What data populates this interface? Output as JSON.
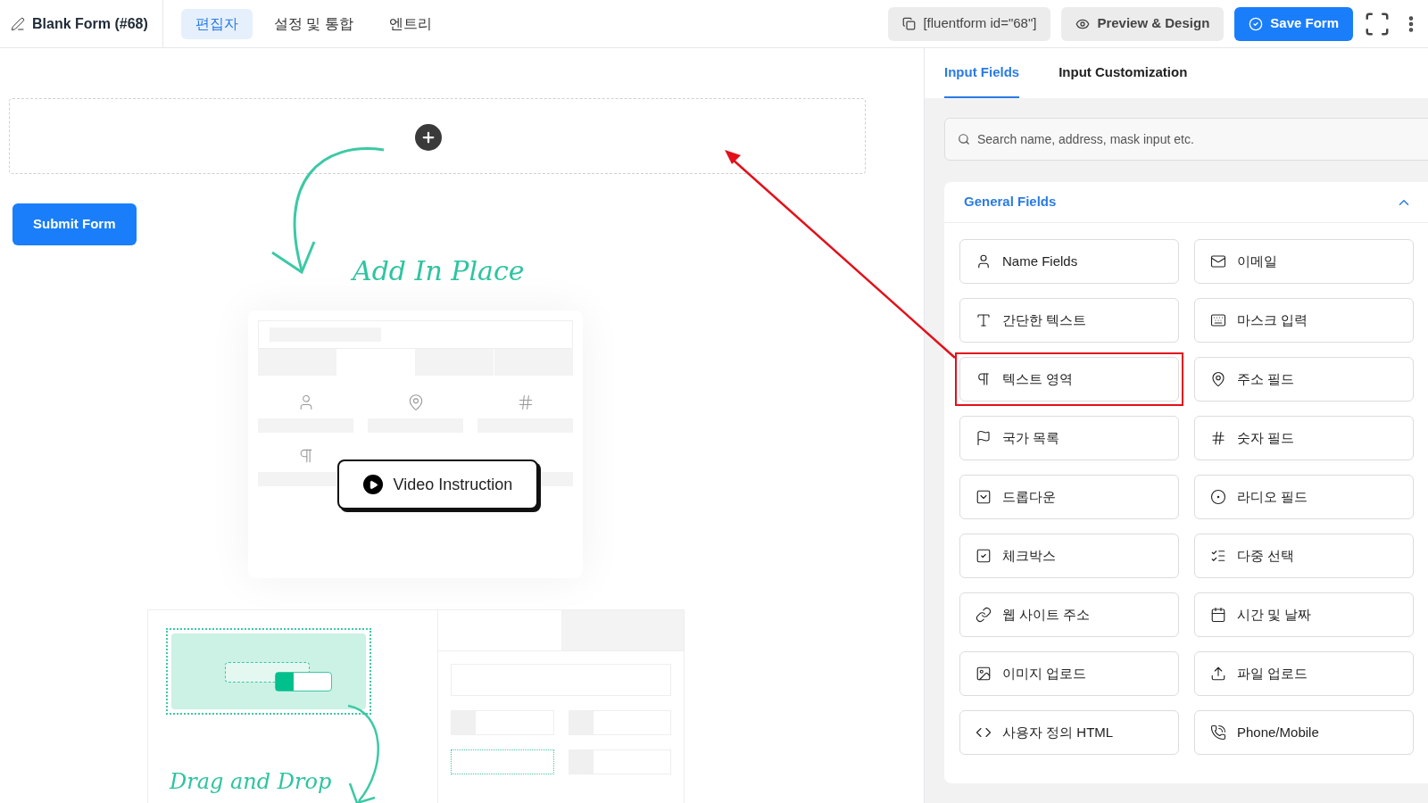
{
  "header": {
    "title": "Blank Form (#68)",
    "tabs": [
      {
        "label": "편집자",
        "selected": true
      },
      {
        "label": "설정 및 통합",
        "selected": false
      },
      {
        "label": "엔트리",
        "selected": false
      }
    ],
    "shortcode": "[fluentform id=\"68\"]",
    "preview": "Preview & Design",
    "save": "Save Form"
  },
  "canvas": {
    "submit": "Submit Form",
    "add_caption": "Add In Place",
    "video": "Video Instruction",
    "drag_caption": "Drag and Drop"
  },
  "panel": {
    "tabs": [
      {
        "label": "Input Fields",
        "selected": true
      },
      {
        "label": "Input Customization",
        "selected": false
      }
    ],
    "search": {
      "placeholder": "Search name, address, mask input etc."
    },
    "section": {
      "title": "General Fields",
      "expanded": true,
      "items": [
        {
          "label": "Name Fields",
          "kind": "user",
          "highlighted": false
        },
        {
          "label": "이메일",
          "kind": "mail",
          "highlighted": false
        },
        {
          "label": "간단한 텍스트",
          "kind": "text",
          "highlighted": false
        },
        {
          "label": "마스크 입력",
          "kind": "keyboard",
          "highlighted": false
        },
        {
          "label": "텍스트 영역",
          "kind": "paragraph",
          "highlighted": true
        },
        {
          "label": "주소 필드",
          "kind": "pin",
          "highlighted": false
        },
        {
          "label": "국가 목록",
          "kind": "flag",
          "highlighted": false
        },
        {
          "label": "숫자 필드",
          "kind": "hash",
          "highlighted": false
        },
        {
          "label": "드롭다운",
          "kind": "dropdown",
          "highlighted": false
        },
        {
          "label": "라디오 필드",
          "kind": "radio",
          "highlighted": false
        },
        {
          "label": "체크박스",
          "kind": "checkbox",
          "highlighted": false
        },
        {
          "label": "다중 선택",
          "kind": "list",
          "highlighted": false
        },
        {
          "label": "웹 사이트 주소",
          "kind": "link",
          "highlighted": false
        },
        {
          "label": "시간 및 날짜",
          "kind": "calendar",
          "highlighted": false
        },
        {
          "label": "이미지 업로드",
          "kind": "image",
          "highlighted": false
        },
        {
          "label": "파일 업로드",
          "kind": "upload",
          "highlighted": false
        },
        {
          "label": "사용자 정의 HTML",
          "kind": "code",
          "highlighted": false
        },
        {
          "label": "Phone/Mobile",
          "kind": "phone",
          "highlighted": false
        }
      ]
    }
  }
}
